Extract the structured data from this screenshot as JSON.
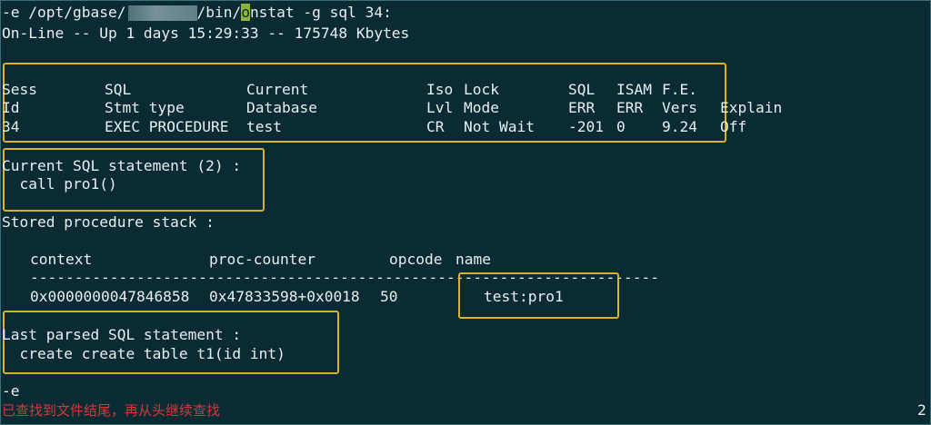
{
  "terminal": {
    "command_before_path": "-e /opt/gbase/",
    "command_mid_path": "/bin/",
    "command_cursor_char": "o",
    "command_after_cursor": "nstat -g sql 34:",
    "status_line": "On-Line -- Up 1 days 15:29:33 -- 175748 Kbytes",
    "session_table": {
      "header_row1": [
        "Sess",
        "SQL",
        "Current",
        "Iso",
        "Lock",
        "SQL",
        "ISAM",
        "F.E.",
        ""
      ],
      "header_row2": [
        "Id",
        "Stmt type",
        "Database",
        "Lvl",
        "Mode",
        "ERR",
        "ERR",
        "Vers",
        "Explain"
      ],
      "row": [
        "34",
        "EXEC PROCEDURE",
        "test",
        "CR",
        "Not Wait",
        "-201",
        "0",
        "9.24",
        "Off"
      ]
    },
    "current_sql_label": "Current SQL statement (2) :",
    "current_sql": "  call pro1()",
    "stack_label": "Stored procedure stack :",
    "stack_table": {
      "headers": [
        "context",
        "proc-counter",
        "opcode",
        "name"
      ],
      "separator": "-----------------------------------------------------------------------",
      "row": [
        "0x0000000047846858",
        "0x47833598+0x0018",
        "50",
        "test:pro1"
      ]
    },
    "last_parsed_label": "Last parsed SQL statement :",
    "last_parsed_sql": "  create create table t1(id int)",
    "trailing_line": "-e",
    "search_message": "已查找到文件结尾，再从头继续查找",
    "page_indicator": "2"
  },
  "colors": {
    "background": "#0a2b33",
    "text": "#e8eef0",
    "highlight_box": "#d9b42a",
    "cursor": "#8fb23a",
    "message": "#d23a3a"
  }
}
